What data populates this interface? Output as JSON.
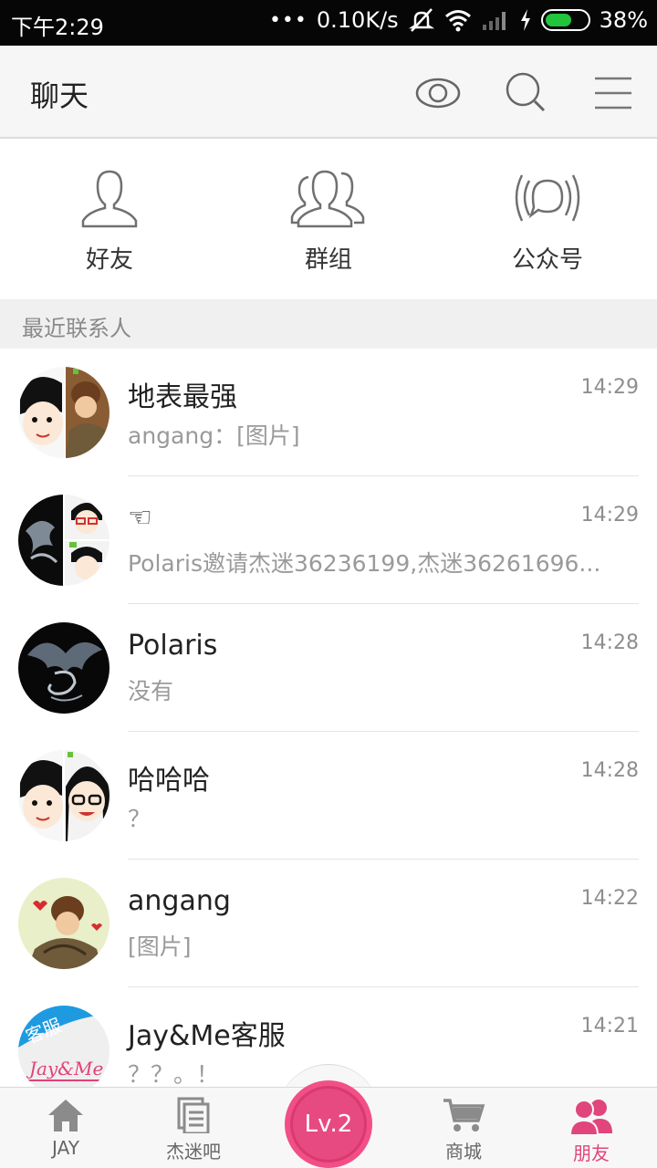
{
  "status_bar": {
    "time": "下午2:29",
    "dots": "•••",
    "speed": "0.10K/s",
    "battery": "38%",
    "battery_level": 0.38,
    "battery_color": "#22c43e"
  },
  "header": {
    "title": "聊天",
    "icons": [
      "eye-icon",
      "search-icon",
      "menu-icon"
    ]
  },
  "quick_entries": [
    {
      "label": "好友",
      "icon": "person-icon"
    },
    {
      "label": "群组",
      "icon": "group-icon"
    },
    {
      "label": "公众号",
      "icon": "broadcast-icon"
    }
  ],
  "section_label": "最近联系人",
  "conversations": [
    {
      "name": "地表最强",
      "time": "14:29",
      "preview": "angang：[图片]"
    },
    {
      "name": "☜",
      "time": "14:29",
      "preview": "Polaris邀请杰迷36236199,杰迷36261696..."
    },
    {
      "name": "Polaris",
      "time": "14:28",
      "preview": "没有"
    },
    {
      "name": "哈哈哈",
      "time": "14:28",
      "preview": "？"
    },
    {
      "name": "angang",
      "time": "14:22",
      "preview": "[图片]"
    },
    {
      "name": "Jay&Me客服",
      "time": "14:21",
      "preview": "？？。！",
      "badge": "客服",
      "logo_text": "Jay&Me"
    }
  ],
  "bottom_nav": {
    "items": [
      {
        "label": "JAY",
        "icon": "home-icon"
      },
      {
        "label": "杰迷吧",
        "icon": "document-icon"
      },
      {
        "label": "商城",
        "icon": "cart-icon"
      },
      {
        "label": "朋友",
        "icon": "friends-icon"
      }
    ],
    "level": "Lv.2",
    "active": "朋友",
    "accent": "#e74a80"
  }
}
